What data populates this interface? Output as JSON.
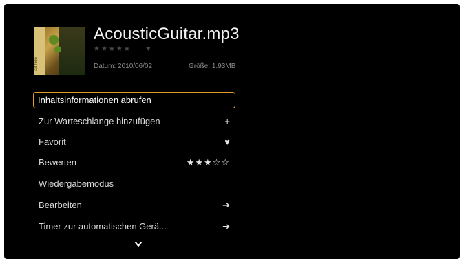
{
  "header": {
    "title": "AcousticGuitar.mp3",
    "rating_stars": "★★★★★",
    "heart": "♥",
    "date": "Datum: 2010/06/02",
    "size": "Größe: 1.93MB",
    "thumb_label": "art-folio"
  },
  "menu": {
    "items": [
      {
        "label": "Inhaltsinformationen abrufen",
        "right": "",
        "selected": true
      },
      {
        "label": "Zur Warteschlange hinzufügen",
        "right": "+",
        "right_icon": "plus-icon"
      },
      {
        "label": "Favorit",
        "right": "♥",
        "right_icon": "heart-icon"
      },
      {
        "label": "Bewerten",
        "right": "★★★☆☆",
        "right_icon": "stars-icon",
        "rating": 3
      },
      {
        "label": "Wiedergabemodus",
        "right": ""
      },
      {
        "label": "Bearbeiten",
        "right": "➔",
        "right_icon": "arrow-right-icon"
      },
      {
        "label": "Timer zur automatischen Gerä...",
        "right": "➔",
        "right_icon": "arrow-right-icon"
      }
    ]
  },
  "colors": {
    "background": "#000000",
    "selection_border": "#e39b2b",
    "text": "#d8d8d8",
    "title": "#f2f2f2"
  }
}
